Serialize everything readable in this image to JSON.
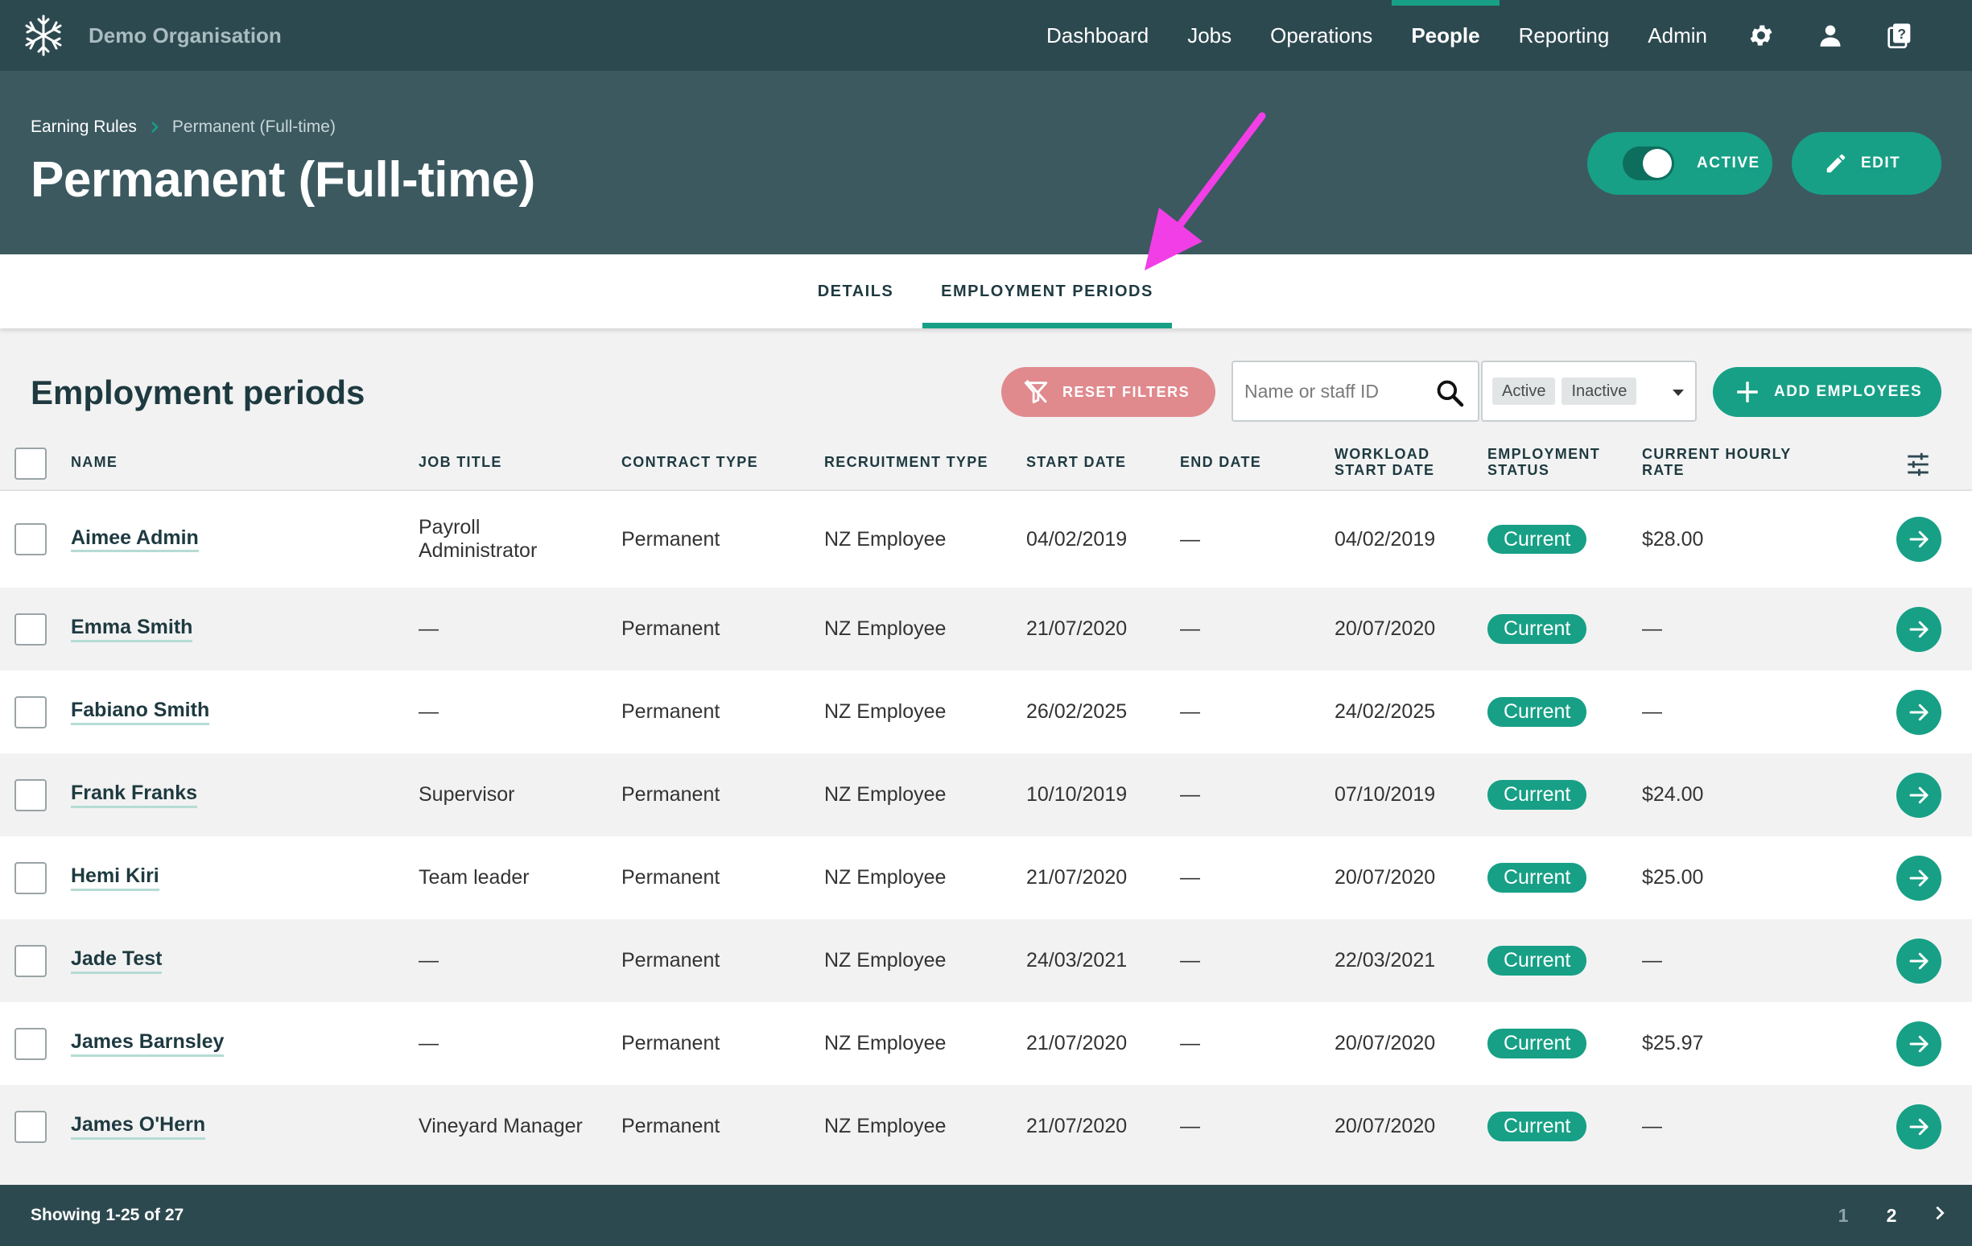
{
  "app": {
    "org_name": "Demo Organisation"
  },
  "nav": {
    "items": [
      "Dashboard",
      "Jobs",
      "Operations",
      "People",
      "Reporting",
      "Admin"
    ],
    "active": "People"
  },
  "breadcrumb": {
    "parent": "Earning Rules",
    "current": "Permanent (Full-time)"
  },
  "page_title": "Permanent (Full-time)",
  "header_actions": {
    "active_label": "ACTIVE",
    "edit_label": "EDIT"
  },
  "tabs": {
    "details": "DETAILS",
    "employment_periods": "EMPLOYMENT PERIODS"
  },
  "section": {
    "title": "Employment periods",
    "reset_filters": "RESET FILTERS",
    "search_placeholder": "Name or staff ID",
    "status_chips": [
      "Active",
      "Inactive"
    ],
    "add_employees": "ADD EMPLOYEES"
  },
  "table": {
    "columns": {
      "name": "NAME",
      "job_title": "JOB TITLE",
      "contract_type": "CONTRACT TYPE",
      "recruitment_type": "RECRUITMENT TYPE",
      "start_date": "START DATE",
      "end_date": "END DATE",
      "workload_start_date": "WORKLOAD START DATE",
      "employment_status": "EMPLOYMENT STATUS",
      "current_hourly_rate": "CURRENT HOURLY RATE"
    },
    "rows": [
      {
        "name": "Aimee Admin",
        "job_title": "Payroll Administrator",
        "contract_type": "Permanent",
        "recruitment_type": "NZ Employee",
        "start_date": "04/02/2019",
        "end_date": "—",
        "workload_start_date": "04/02/2019",
        "status": "Current",
        "rate": "$28.00"
      },
      {
        "name": "Emma Smith",
        "job_title": "—",
        "contract_type": "Permanent",
        "recruitment_type": "NZ Employee",
        "start_date": "21/07/2020",
        "end_date": "—",
        "workload_start_date": "20/07/2020",
        "status": "Current",
        "rate": "—"
      },
      {
        "name": "Fabiano Smith",
        "job_title": "—",
        "contract_type": "Permanent",
        "recruitment_type": "NZ Employee",
        "start_date": "26/02/2025",
        "end_date": "—",
        "workload_start_date": "24/02/2025",
        "status": "Current",
        "rate": "—"
      },
      {
        "name": "Frank Franks",
        "job_title": "Supervisor",
        "contract_type": "Permanent",
        "recruitment_type": "NZ Employee",
        "start_date": "10/10/2019",
        "end_date": "—",
        "workload_start_date": "07/10/2019",
        "status": "Current",
        "rate": "$24.00"
      },
      {
        "name": "Hemi Kiri",
        "job_title": "Team leader",
        "contract_type": "Permanent",
        "recruitment_type": "NZ Employee",
        "start_date": "21/07/2020",
        "end_date": "—",
        "workload_start_date": "20/07/2020",
        "status": "Current",
        "rate": "$25.00"
      },
      {
        "name": "Jade Test",
        "job_title": "—",
        "contract_type": "Permanent",
        "recruitment_type": "NZ Employee",
        "start_date": "24/03/2021",
        "end_date": "—",
        "workload_start_date": "22/03/2021",
        "status": "Current",
        "rate": "—"
      },
      {
        "name": "James Barnsley",
        "job_title": "—",
        "contract_type": "Permanent",
        "recruitment_type": "NZ Employee",
        "start_date": "21/07/2020",
        "end_date": "—",
        "workload_start_date": "20/07/2020",
        "status": "Current",
        "rate": "$25.97"
      },
      {
        "name": "James O'Hern",
        "job_title": "Vineyard Manager",
        "contract_type": "Permanent",
        "recruitment_type": "NZ Employee",
        "start_date": "21/07/2020",
        "end_date": "—",
        "workload_start_date": "20/07/2020",
        "status": "Current",
        "rate": "—"
      }
    ]
  },
  "footer": {
    "showing": "Showing 1-25 of 27",
    "pages": [
      "1",
      "2"
    ],
    "current_page": "2"
  },
  "icons": [
    "snowflake-logo-icon",
    "settings-icon",
    "user-icon",
    "help-book-icon",
    "chevron-right-icon",
    "pencil-icon",
    "filter-off-icon",
    "search-icon",
    "plus-icon",
    "sliders-icon",
    "arrow-right-icon"
  ],
  "colors": {
    "nav_bg": "#2d4950",
    "header_bg": "#3c5960",
    "accent": "#17a086",
    "reset": "#e08a8e",
    "annotation_arrow": "#f23ee6"
  }
}
